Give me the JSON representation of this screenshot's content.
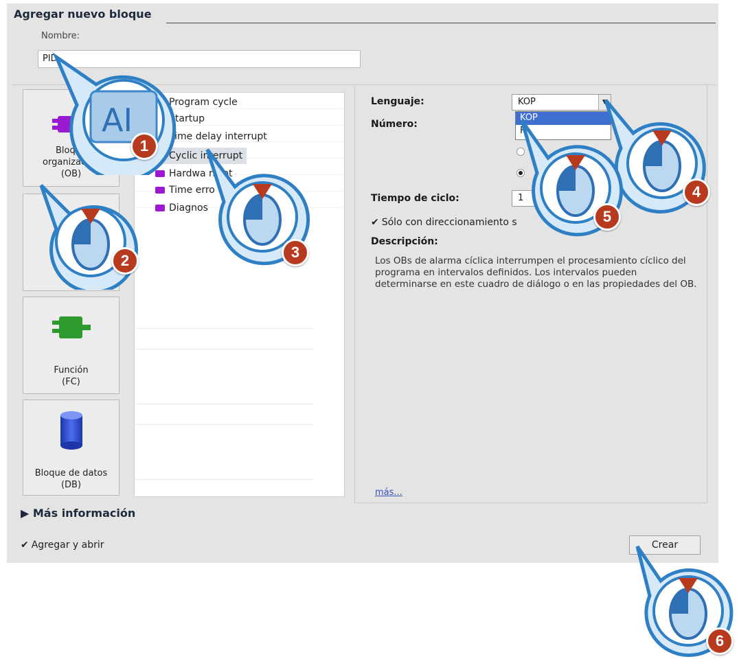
{
  "dialog": {
    "title": "Agregar nuevo bloque",
    "name_label": "Nombre:",
    "name_value": "PID"
  },
  "block_types": [
    {
      "label_line1": "Bloque",
      "label_line2": "organización",
      "label_line3": "(OB)",
      "icon": "ob-block-icon",
      "color": "#9b1ad1"
    },
    {
      "label_line3": "(",
      "icon": "fb-block-icon"
    },
    {
      "label_line1": "Función",
      "label_line2": "(FC)",
      "icon": "fc-block-icon",
      "color": "#2e9a2e"
    },
    {
      "label_line1": "Bloque de datos",
      "label_line2": "(DB)",
      "icon": "db-block-icon",
      "color": "#2b4fd6"
    }
  ],
  "ob_list": [
    {
      "label": "Program cycle"
    },
    {
      "label": "Startup"
    },
    {
      "label": "Time delay interrupt"
    },
    {
      "label": "Cyclic interrupt",
      "selected": true
    },
    {
      "label": "Hardwa     rrupt"
    },
    {
      "label": "Time erro"
    },
    {
      "label": "Diagnos"
    }
  ],
  "settings": {
    "language_label": "Lenguaje:",
    "language_value": "KOP",
    "language_options": [
      "KOP",
      "F"
    ],
    "number_label": "Número:",
    "cycle_label": "Tiempo de ciclo:",
    "cycle_value": "1",
    "symbolic_label": "Sólo con direccionamiento s",
    "description_label": "Descripción:",
    "description_text": "Los OBs de alarma cíclica interrumpen el procesamiento cíclico del programa en intervalos definidos. Los intervalos pueden determinarse en este cuadro de diálogo o en las propiedades del OB.",
    "more_link": "más..."
  },
  "footer": {
    "more_info_label": "Más información",
    "add_open_label": "Agregar y abrir",
    "create_label": "Crear"
  },
  "callouts": [
    "1",
    "2",
    "3",
    "4",
    "5",
    "6"
  ],
  "colors": {
    "callout_badge": "#b83a1e",
    "bubble": "#3d8fd4",
    "selected_row": "#dbe0e6"
  }
}
